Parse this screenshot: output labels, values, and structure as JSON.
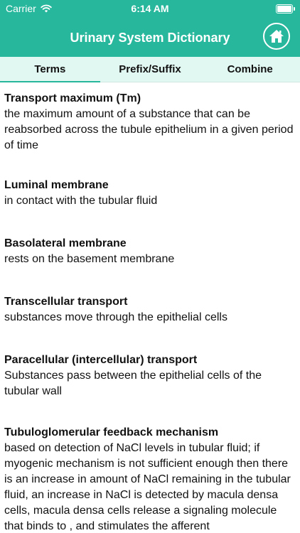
{
  "status": {
    "carrier": "Carrier",
    "time": "6:14 AM"
  },
  "nav": {
    "title": "Urinary System Dictionary"
  },
  "tabs": [
    {
      "label": "Terms",
      "active": true
    },
    {
      "label": "Prefix/Suffix",
      "active": false
    },
    {
      "label": "Combine",
      "active": false
    }
  ],
  "entries": [
    {
      "term": "Transport maximum (Tm)",
      "definition": "the maximum amount of a substance that can be reabsorbed across the tubule epithelium in a given period of time"
    },
    {
      "term": "Luminal membrane",
      "definition": "in contact with the tubular fluid"
    },
    {
      "term": "Basolateral membrane",
      "definition": "rests on the basement membrane"
    },
    {
      "term": "Transcellular transport",
      "definition": "substances move through the epithelial cells"
    },
    {
      "term": "Paracellular (intercellular) transport",
      "definition": "Substances pass between the epithelial cells of the tubular wall"
    },
    {
      "term": "Tubuloglomerular feedback mechanism",
      "definition": "based on detection of NaCl levels in tubular fluid; if myogenic mechanism is not sufficient enough then there is an increase in amount of NaCl remaining in the tubular fluid, an increase in NaCl is detected by macula densa cells, macula densa cells release a signaling molecule that binds to , and stimulates the afferent"
    }
  ]
}
